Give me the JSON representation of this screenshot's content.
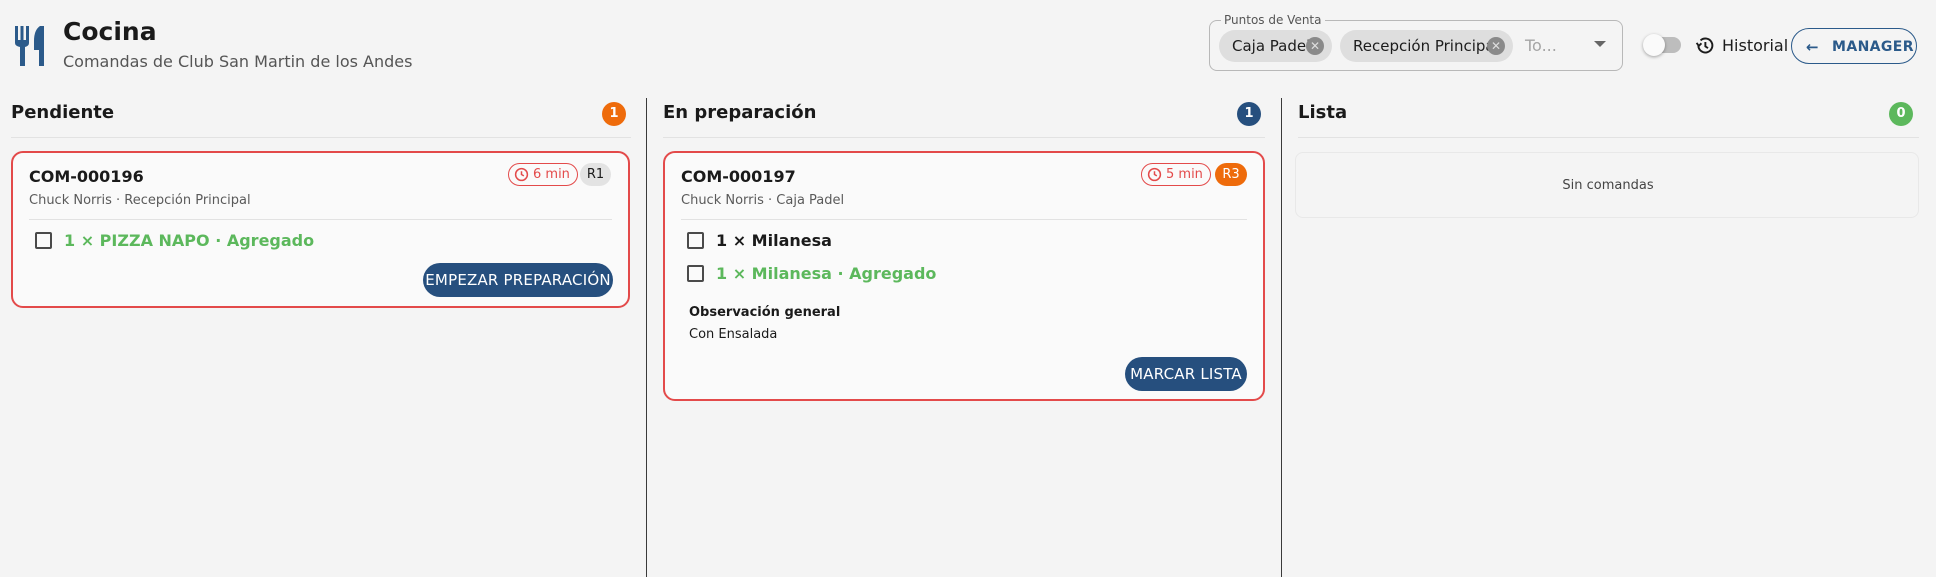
{
  "header": {
    "title": "Cocina",
    "subtitle": "Comandas de Club San Martin de los Andes",
    "logo_icon": "utensils-icon"
  },
  "pos_filter": {
    "legend": "Puntos de Venta",
    "chips": [
      "Caja Padel",
      "Recepción Principal"
    ],
    "placeholder": "To..."
  },
  "toolbar": {
    "toggle_on": false,
    "history_label": "Historial",
    "manager_label": "MANAGER"
  },
  "colors": {
    "pending_badge": "#ee6b0b",
    "prep_badge": "#264f7e",
    "ready_badge": "#5cb85c",
    "card_border": "#e34a4a",
    "item_added": "#5cb85c",
    "primary_button": "#264f7e"
  },
  "columns": {
    "pending": {
      "title": "Pendiente",
      "count": "1",
      "card": {
        "code": "COM-000196",
        "meta": "Chuck Norris · Recepción Principal",
        "time": "6 min",
        "reservation": "R1",
        "items": [
          "1 × PIZZA NAPO · Agregado"
        ],
        "action": "EMPEZAR PREPARACIÓN"
      }
    },
    "preparing": {
      "title": "En preparación",
      "count": "1",
      "card": {
        "code": "COM-000197",
        "meta": "Chuck Norris · Caja Padel",
        "time": "5 min",
        "reservation": "R3",
        "items": [
          "1 × Milanesa",
          "1 × Milanesa · Agregado"
        ],
        "observation_label": "Observación general",
        "observation_text": "Con Ensalada",
        "action": "MARCAR LISTA"
      }
    },
    "ready": {
      "title": "Lista",
      "count": "0",
      "empty_text": "Sin comandas"
    }
  }
}
